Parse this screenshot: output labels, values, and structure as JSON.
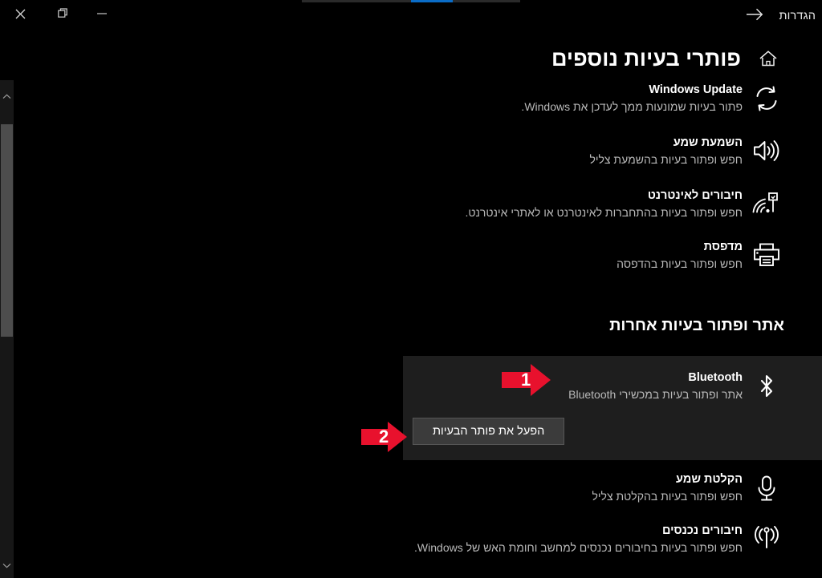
{
  "window": {
    "caption_buttons": [
      {
        "name": "close",
        "glyph": "close-icon",
        "label": "Close"
      },
      {
        "name": "restore",
        "glyph": "restore-icon",
        "label": "Restore"
      },
      {
        "name": "minimize",
        "glyph": "minimize-icon",
        "label": "Minimize"
      }
    ]
  },
  "topnav": {
    "back_icon": "arrow-right-icon",
    "app_label": "הגדרות"
  },
  "scrollbar": {
    "up_icon": "chevron-up-icon",
    "down_icon": "chevron-down-icon"
  },
  "page": {
    "home_icon": "home-icon",
    "title": "פותרי בעיות נוספים"
  },
  "recommended": {
    "items": [
      {
        "icon": "sync-refresh-icon",
        "title": "Windows Update",
        "desc": "פתור בעיות שמונעות ממך לעדכן את Windows."
      },
      {
        "icon": "speaker-volume-icon",
        "title": "השמעת שמע",
        "desc": "חפש ופתור בעיות בהשמעת צליל"
      },
      {
        "icon": "network-signal-icon",
        "title": "חיבורים לאינטרנט",
        "desc": "חפש ופתור בעיות בהתחברות לאינטרנט או לאתרי אינטרנט."
      },
      {
        "icon": "printer-icon",
        "title": "מדפסת",
        "desc": "חפש ופתור בעיות בהדפסה"
      }
    ]
  },
  "others": {
    "section_title": "אתר ופתור בעיות אחרות",
    "selected": {
      "icon": "bluetooth-icon",
      "title": "Bluetooth",
      "desc": "אתר ופתור בעיות במכשירי Bluetooth",
      "run_button_label": "הפעל את פותר הבעיות"
    },
    "items": [
      {
        "icon": "microphone-icon",
        "title": "הקלטת שמע",
        "desc": "חפש ופתור בעיות בהקלטת צליל"
      },
      {
        "icon": "incoming-connections-icon",
        "title": "חיבורים נכנסים",
        "desc": "חפש ופתור בעיות בחיבורים נכנסים למחשב וחומת האש של Windows."
      }
    ]
  },
  "annotations": {
    "color": "#e8112d",
    "markers": [
      {
        "number": "1",
        "target": "bluetooth-troubleshooter-row"
      },
      {
        "number": "2",
        "target": "run-troubleshooter-button"
      }
    ]
  }
}
